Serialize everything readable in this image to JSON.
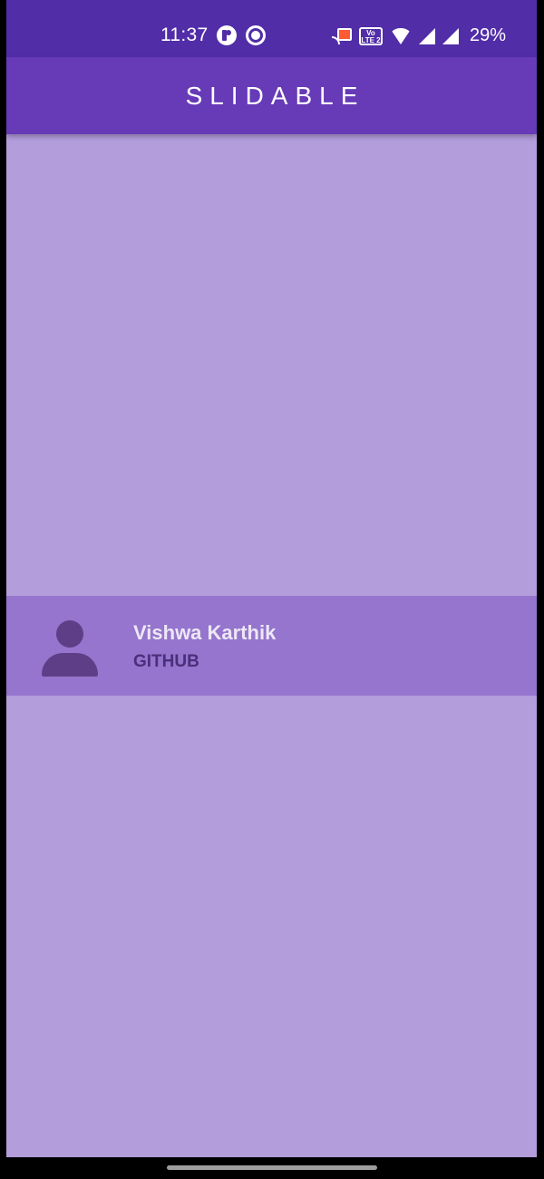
{
  "status_bar": {
    "time": "11:37",
    "volte_label": "Vo LTE 2",
    "battery": "29%"
  },
  "app_bar": {
    "title": "SLIDABLE"
  },
  "list_tile": {
    "title": "Vishwa Karthik",
    "subtitle": "GITHUB"
  },
  "colors": {
    "status_bar": "#512da8",
    "app_bar": "#673ab7",
    "background": "#b39ddb",
    "tile": "#9575cd"
  }
}
